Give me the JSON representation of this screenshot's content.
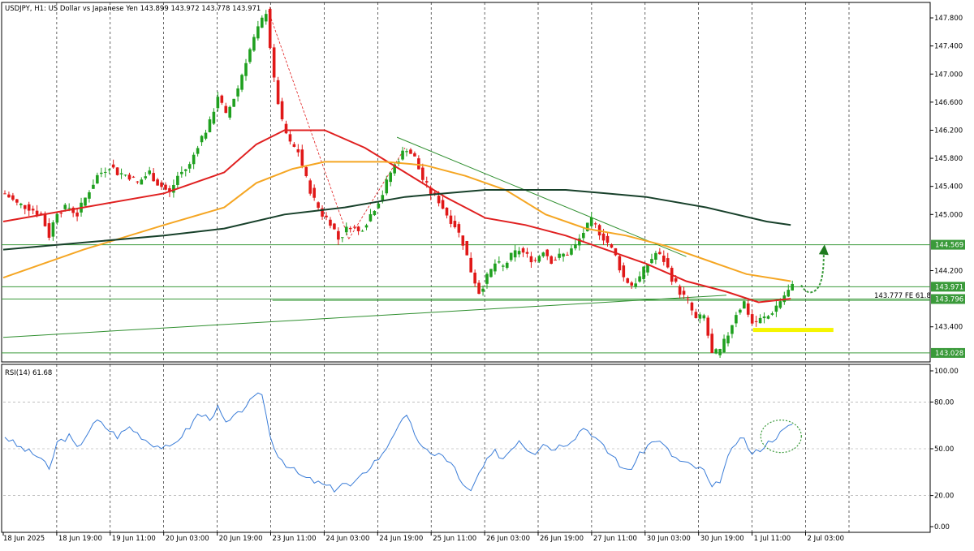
{
  "header": {
    "main_title": "USDJPY, H1:  US Dollar vs Japanese Yen  143.899 143.972 143.778 143.971",
    "rsi_title": "RSI(14) 61.68"
  },
  "colors": {
    "candle_up": "#1fa01f",
    "candle_down": "#e01818",
    "ma_fast": "#e02020",
    "ma_mid": "#f5a623",
    "ma_slow": "#17402a",
    "level_line": "#3a9a3a",
    "trendline": "#2f8f2f",
    "rsi_line": "#3b7dd8",
    "yellow_zone": "#f5f500",
    "grid": "#000000"
  },
  "chart_data": [
    {
      "type": "candlestick",
      "symbol": "USDJPY",
      "timeframe": "H1",
      "ylim": [
        142.9,
        148.02
      ],
      "y_ticks": [
        "147.800",
        "147.400",
        "147.000",
        "146.600",
        "146.200",
        "145.800",
        "145.400",
        "145.000",
        "144.200",
        "143.400"
      ],
      "x_ticks": [
        "18 Jun 2025",
        "18 Jun 19:00",
        "19 Jun 11:00",
        "20 Jun 03:00",
        "20 Jun 19:00",
        "23 Jun 11:00",
        "24 Jun 03:00",
        "24 Jun 19:00",
        "25 Jun 11:00",
        "26 Jun 03:00",
        "26 Jun 19:00",
        "27 Jun 11:00",
        "30 Jun 03:00",
        "30 Jun 19:00",
        "1 Jul 11:00",
        "2 Jul 03:00"
      ],
      "price_path": [
        [
          0,
          145.3
        ],
        [
          3,
          145.15
        ],
        [
          6,
          145.1
        ],
        [
          9,
          145.0
        ],
        [
          11,
          144.7
        ],
        [
          13,
          145.05
        ],
        [
          16,
          145.1
        ],
        [
          18,
          145.0
        ],
        [
          21,
          145.35
        ],
        [
          23,
          145.55
        ],
        [
          26,
          145.7
        ],
        [
          28,
          145.6
        ],
        [
          31,
          145.55
        ],
        [
          33,
          145.45
        ],
        [
          36,
          145.6
        ],
        [
          38,
          145.45
        ],
        [
          41,
          145.3
        ],
        [
          43,
          145.55
        ],
        [
          46,
          145.7
        ],
        [
          48,
          146.0
        ],
        [
          51,
          146.3
        ],
        [
          53,
          146.7
        ],
        [
          55,
          146.4
        ],
        [
          58,
          146.8
        ],
        [
          60,
          147.2
        ],
        [
          62,
          147.5
        ],
        [
          65,
          147.9
        ],
        [
          67,
          146.9
        ],
        [
          69,
          146.3
        ],
        [
          71,
          146.0
        ],
        [
          73,
          145.9
        ],
        [
          75,
          145.5
        ],
        [
          77,
          145.2
        ],
        [
          79,
          145.0
        ],
        [
          81,
          144.9
        ],
        [
          83,
          144.65
        ],
        [
          86,
          144.85
        ],
        [
          88,
          144.75
        ],
        [
          90,
          144.9
        ],
        [
          92,
          145.1
        ],
        [
          94,
          145.3
        ],
        [
          96,
          145.6
        ],
        [
          98,
          145.8
        ],
        [
          100,
          145.95
        ],
        [
          102,
          145.8
        ],
        [
          104,
          145.5
        ],
        [
          106,
          145.3
        ],
        [
          108,
          145.2
        ],
        [
          110,
          145.0
        ],
        [
          112,
          144.85
        ],
        [
          114,
          144.6
        ],
        [
          116,
          144.2
        ],
        [
          118,
          143.9
        ],
        [
          120,
          144.1
        ],
        [
          122,
          144.3
        ],
        [
          124,
          144.25
        ],
        [
          126,
          144.4
        ],
        [
          128,
          144.5
        ],
        [
          130,
          144.4
        ],
        [
          132,
          144.35
        ],
        [
          134,
          144.5
        ],
        [
          136,
          144.35
        ],
        [
          138,
          144.4
        ],
        [
          140,
          144.45
        ],
        [
          142,
          144.55
        ],
        [
          144,
          144.75
        ],
        [
          146,
          144.9
        ],
        [
          148,
          144.75
        ],
        [
          150,
          144.6
        ],
        [
          152,
          144.4
        ],
        [
          154,
          144.1
        ],
        [
          156,
          144.0
        ],
        [
          158,
          144.1
        ],
        [
          160,
          144.3
        ],
        [
          162,
          144.45
        ],
        [
          164,
          144.35
        ],
        [
          166,
          144.1
        ],
        [
          168,
          143.9
        ],
        [
          170,
          143.75
        ],
        [
          172,
          143.5
        ],
        [
          174,
          143.55
        ],
        [
          176,
          143.0
        ],
        [
          178,
          143.05
        ],
        [
          180,
          143.3
        ],
        [
          182,
          143.6
        ],
        [
          184,
          143.75
        ],
        [
          186,
          143.45
        ],
        [
          188,
          143.5
        ],
        [
          190,
          143.55
        ],
        [
          192,
          143.7
        ],
        [
          194,
          143.85
        ],
        [
          196,
          143.97
        ]
      ],
      "moving_averages": [
        {
          "color_key": "ma_fast",
          "points": [
            [
              0,
              144.9
            ],
            [
              20,
              145.1
            ],
            [
              40,
              145.3
            ],
            [
              55,
              145.6
            ],
            [
              63,
              146.0
            ],
            [
              70,
              146.2
            ],
            [
              80,
              146.2
            ],
            [
              90,
              145.95
            ],
            [
              100,
              145.6
            ],
            [
              110,
              145.25
            ],
            [
              120,
              144.95
            ],
            [
              130,
              144.85
            ],
            [
              140,
              144.7
            ],
            [
              150,
              144.5
            ],
            [
              160,
              144.3
            ],
            [
              170,
              144.05
            ],
            [
              180,
              143.9
            ],
            [
              188,
              143.75
            ],
            [
              196,
              143.8
            ]
          ]
        },
        {
          "color_key": "ma_mid",
          "points": [
            [
              0,
              144.1
            ],
            [
              20,
              144.5
            ],
            [
              40,
              144.85
            ],
            [
              55,
              145.1
            ],
            [
              63,
              145.45
            ],
            [
              72,
              145.65
            ],
            [
              80,
              145.75
            ],
            [
              95,
              145.75
            ],
            [
              105,
              145.7
            ],
            [
              115,
              145.55
            ],
            [
              125,
              145.35
            ],
            [
              135,
              145.0
            ],
            [
              145,
              144.8
            ],
            [
              155,
              144.7
            ],
            [
              165,
              144.55
            ],
            [
              175,
              144.35
            ],
            [
              185,
              144.15
            ],
            [
              196,
              144.05
            ]
          ]
        },
        {
          "color_key": "ma_slow",
          "points": [
            [
              0,
              144.5
            ],
            [
              20,
              144.6
            ],
            [
              40,
              144.7
            ],
            [
              55,
              144.8
            ],
            [
              70,
              145.0
            ],
            [
              85,
              145.1
            ],
            [
              100,
              145.25
            ],
            [
              110,
              145.3
            ],
            [
              120,
              145.35
            ],
            [
              140,
              145.35
            ],
            [
              150,
              145.3
            ],
            [
              160,
              145.25
            ],
            [
              175,
              145.1
            ],
            [
              190,
              144.9
            ],
            [
              196,
              144.85
            ]
          ]
        }
      ],
      "horizontal_levels": [
        {
          "price": 144.569,
          "label": "144.569"
        },
        {
          "price": 143.971,
          "label": "143.971",
          "current": true
        },
        {
          "price": 143.796,
          "label": "143.796"
        },
        {
          "price": 143.028,
          "label": "143.028"
        }
      ],
      "level_annotation": {
        "price": 143.777,
        "text": "143.777 FE 61.8"
      },
      "trendlines": [
        {
          "from": [
            0,
            143.25
          ],
          "to": [
            180,
            143.85
          ]
        },
        {
          "from": [
            98,
            146.1
          ],
          "to": [
            170,
            144.4
          ]
        }
      ],
      "fibo_lines": [
        {
          "from": [
            66,
            147.9
          ],
          "to": [
            86,
            144.65
          ]
        },
        {
          "from": [
            86,
            144.65
          ],
          "to": [
            100,
            145.95
          ]
        }
      ],
      "support_zone": {
        "from_x": 185,
        "to_x": 204,
        "price": 143.35
      },
      "arrow": {
        "from": [
          197,
          143.97
        ],
        "to": [
          203,
          144.55
        ]
      }
    },
    {
      "type": "line",
      "name": "RSI(14)",
      "ylim": [
        0,
        100
      ],
      "y_ticks": [
        "100.00",
        "80.00",
        "50.00",
        "20.00",
        "0.00"
      ],
      "levels": [
        80,
        50,
        20
      ],
      "value_path": [
        [
          0,
          58
        ],
        [
          3,
          52
        ],
        [
          6,
          48
        ],
        [
          9,
          44
        ],
        [
          11,
          36
        ],
        [
          13,
          54
        ],
        [
          16,
          58
        ],
        [
          18,
          50
        ],
        [
          21,
          62
        ],
        [
          23,
          68
        ],
        [
          26,
          62
        ],
        [
          28,
          58
        ],
        [
          31,
          64
        ],
        [
          33,
          60
        ],
        [
          36,
          54
        ],
        [
          38,
          52
        ],
        [
          41,
          50
        ],
        [
          43,
          56
        ],
        [
          46,
          64
        ],
        [
          48,
          72
        ],
        [
          51,
          70
        ],
        [
          53,
          76
        ],
        [
          55,
          66
        ],
        [
          58,
          72
        ],
        [
          60,
          78
        ],
        [
          62,
          82
        ],
        [
          64,
          86
        ],
        [
          66,
          58
        ],
        [
          68,
          46
        ],
        [
          70,
          40
        ],
        [
          72,
          36
        ],
        [
          74,
          32
        ],
        [
          76,
          30
        ],
        [
          78,
          28
        ],
        [
          80,
          26
        ],
        [
          82,
          24
        ],
        [
          84,
          28
        ],
        [
          86,
          26
        ],
        [
          88,
          30
        ],
        [
          90,
          36
        ],
        [
          92,
          42
        ],
        [
          94,
          46
        ],
        [
          96,
          56
        ],
        [
          98,
          66
        ],
        [
          100,
          70
        ],
        [
          102,
          60
        ],
        [
          104,
          50
        ],
        [
          106,
          46
        ],
        [
          108,
          48
        ],
        [
          110,
          42
        ],
        [
          112,
          38
        ],
        [
          114,
          26
        ],
        [
          116,
          22
        ],
        [
          118,
          34
        ],
        [
          120,
          42
        ],
        [
          122,
          48
        ],
        [
          124,
          44
        ],
        [
          126,
          50
        ],
        [
          128,
          56
        ],
        [
          130,
          50
        ],
        [
          132,
          48
        ],
        [
          134,
          54
        ],
        [
          136,
          50
        ],
        [
          138,
          52
        ],
        [
          140,
          54
        ],
        [
          142,
          58
        ],
        [
          144,
          64
        ],
        [
          146,
          60
        ],
        [
          148,
          54
        ],
        [
          150,
          48
        ],
        [
          152,
          44
        ],
        [
          154,
          36
        ],
        [
          156,
          38
        ],
        [
          158,
          46
        ],
        [
          160,
          52
        ],
        [
          162,
          56
        ],
        [
          164,
          52
        ],
        [
          166,
          46
        ],
        [
          168,
          42
        ],
        [
          170,
          40
        ],
        [
          172,
          38
        ],
        [
          174,
          36
        ],
        [
          176,
          24
        ],
        [
          178,
          30
        ],
        [
          180,
          44
        ],
        [
          182,
          54
        ],
        [
          184,
          56
        ],
        [
          186,
          46
        ],
        [
          188,
          50
        ],
        [
          190,
          54
        ],
        [
          192,
          58
        ],
        [
          194,
          62
        ],
        [
          196,
          66
        ]
      ],
      "highlight_circle": {
        "x": 194,
        "value": 58
      }
    }
  ]
}
